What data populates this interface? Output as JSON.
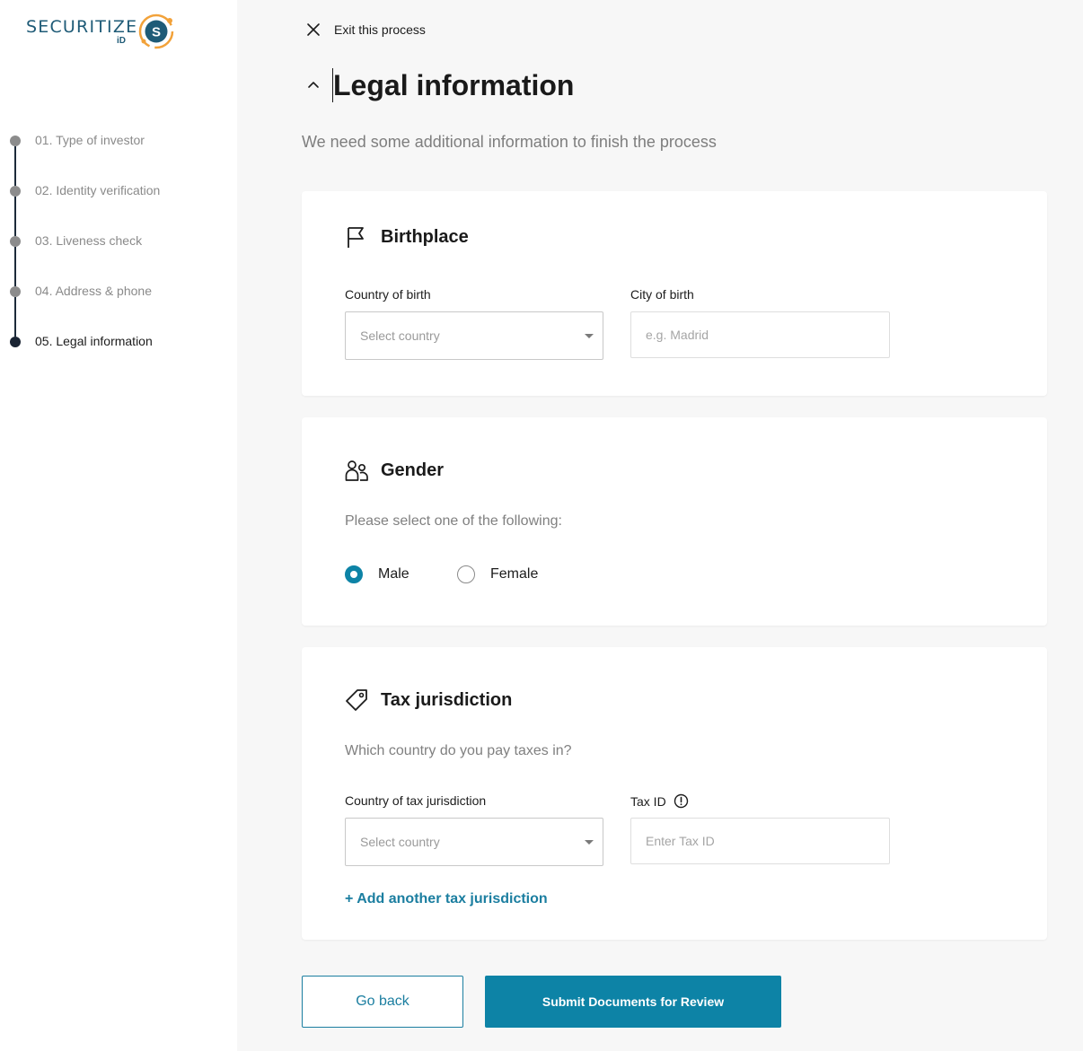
{
  "brand": {
    "name": "SECURITIZE",
    "sub": "iD",
    "mark_letter": "S",
    "primary_color": "#1f5b77",
    "accent_color": "#f2a23a"
  },
  "sidebar": {
    "steps": [
      {
        "label": "01. Type of investor",
        "state": "done"
      },
      {
        "label": "02. Identity verification",
        "state": "done"
      },
      {
        "label": "03. Liveness check",
        "state": "done"
      },
      {
        "label": "04. Address & phone",
        "state": "done"
      },
      {
        "label": "05. Legal information",
        "state": "active"
      }
    ]
  },
  "header": {
    "exit_label": "Exit this process",
    "title": "Legal information",
    "subtitle": "We need some additional information to finish the process"
  },
  "birthplace": {
    "title": "Birthplace",
    "icon": "flag-icon",
    "country_label": "Country of birth",
    "country_placeholder": "Select country",
    "city_label": "City of birth",
    "city_placeholder": "e.g. Madrid"
  },
  "gender": {
    "title": "Gender",
    "icon": "users-icon",
    "prompt": "Please select one of the following:",
    "options": [
      {
        "label": "Male",
        "selected": true
      },
      {
        "label": "Female",
        "selected": false
      }
    ]
  },
  "tax": {
    "title": "Tax jurisdiction",
    "icon": "tag-icon",
    "prompt": "Which country do you pay taxes in?",
    "country_label": "Country of tax jurisdiction",
    "country_placeholder": "Select country",
    "taxid_label": "Tax ID",
    "taxid_placeholder": "Enter Tax ID",
    "add_link": "+ Add another tax jurisdiction"
  },
  "actions": {
    "back_label": "Go back",
    "submit_label": "Submit Documents for Review",
    "primary_color": "#0d83a6"
  }
}
